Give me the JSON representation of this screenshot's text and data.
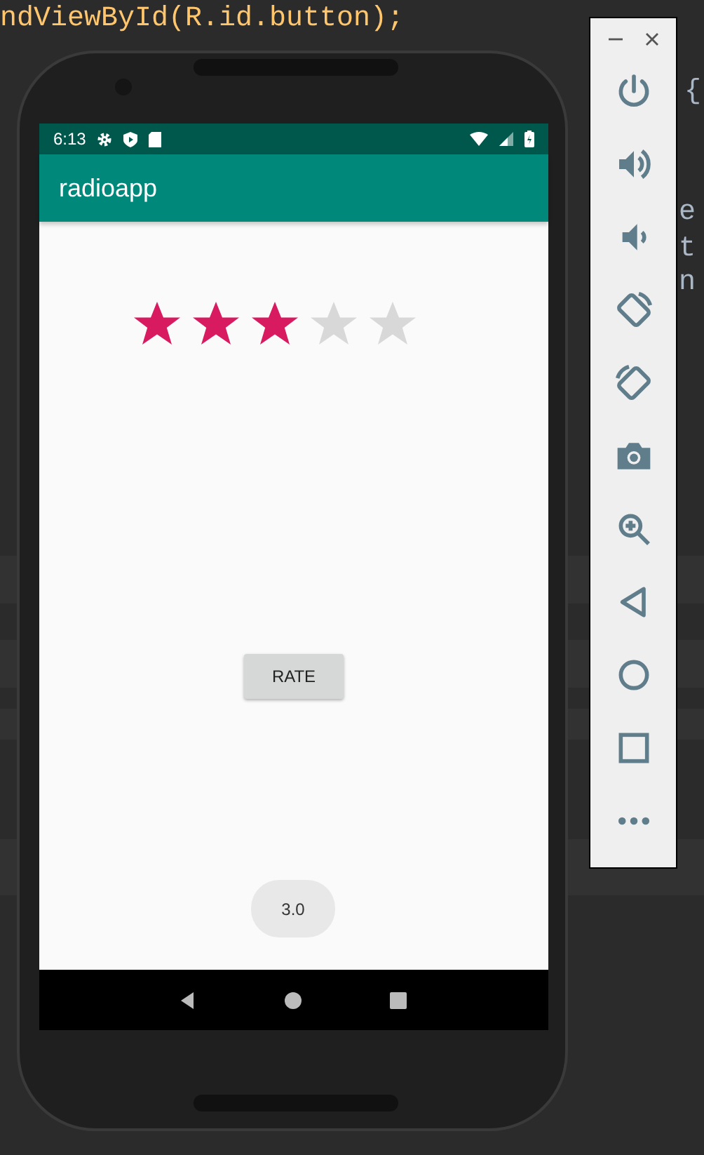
{
  "editor": {
    "lines": [
      {
        "text": "ndViewById(R.id.button);"
      }
    ],
    "right_lines": [
      {
        "text": "{"
      },
      {
        "text": "e"
      },
      {
        "text": "t"
      },
      {
        "text": "n"
      }
    ]
  },
  "status_bar": {
    "time": "6:13"
  },
  "app_bar": {
    "title": "radioapp"
  },
  "rating": {
    "stars": 3
  },
  "rate_button": {
    "label": "RATE"
  },
  "toast": {
    "text": "3.0"
  }
}
